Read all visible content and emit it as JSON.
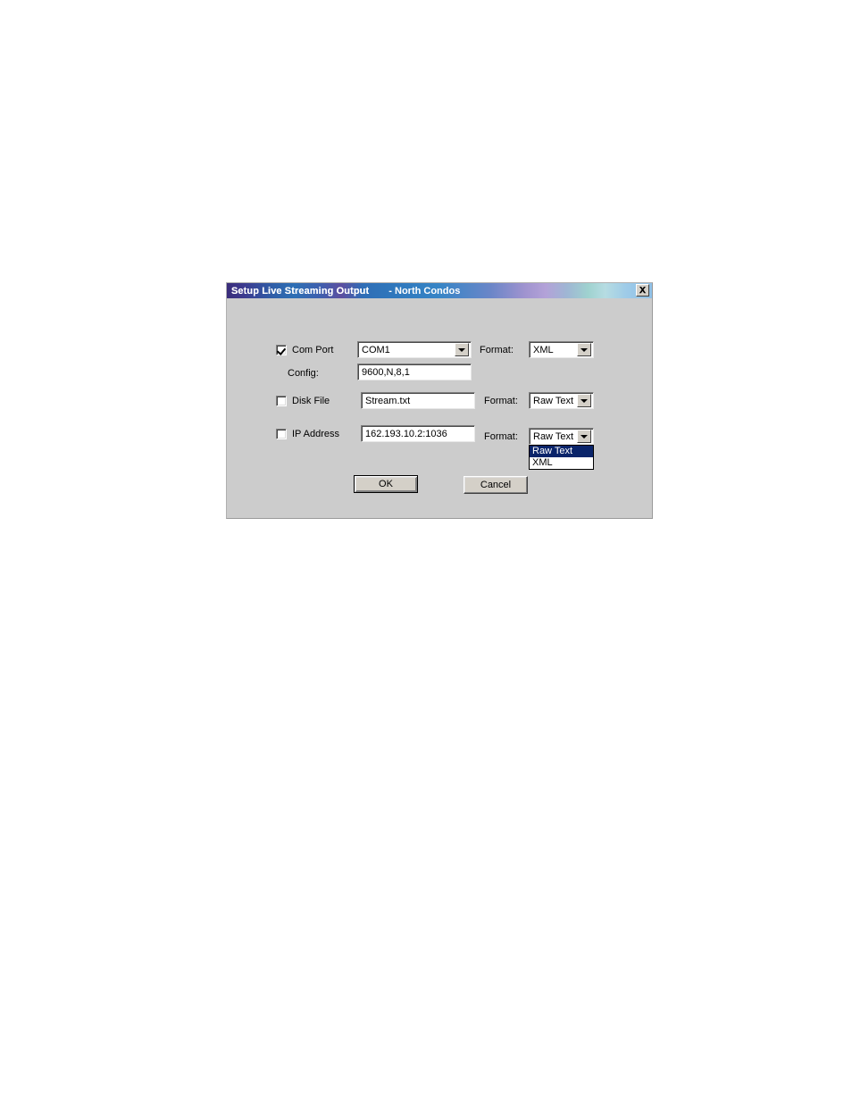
{
  "window": {
    "title_primary": "Setup Live Streaming Output",
    "title_secondary": "- North Condos",
    "close_icon": "close-icon",
    "accent_titlebar_start": "#3a2d7a",
    "accent_titlebar_end": "#8fc0e6",
    "dialog_background": "#cccccc",
    "highlight_color": "#0a246a"
  },
  "form": {
    "com_port": {
      "checkbox_label": "Com Port",
      "checked": true,
      "port_value": "COM1",
      "format_label": "Format:",
      "format_value": "XML",
      "config_label": "Config:",
      "config_value": "9600,N,8,1"
    },
    "disk_file": {
      "checkbox_label": "Disk File",
      "checked": false,
      "file_value": "Stream.txt",
      "format_label": "Format:",
      "format_value": "Raw Text"
    },
    "ip_address": {
      "checkbox_label": "IP Address",
      "checked": false,
      "address_value": "162.193.10.2:1036",
      "format_label": "Format:",
      "format_value": "Raw Text",
      "format_options": [
        {
          "label": "Raw Text",
          "selected": true
        },
        {
          "label": "XML",
          "selected": false
        }
      ]
    }
  },
  "buttons": {
    "ok_label": "OK",
    "cancel_label": "Cancel"
  }
}
